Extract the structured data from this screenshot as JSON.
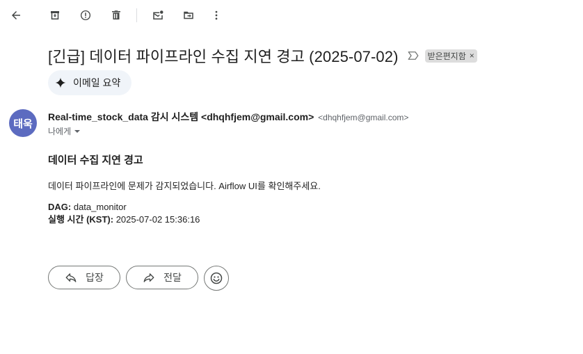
{
  "toolbar": {
    "icons": [
      "back-arrow-icon",
      "archive-icon",
      "report-spam-icon",
      "delete-icon",
      "mark-unread-icon",
      "move-to-icon",
      "more-options-icon"
    ]
  },
  "email": {
    "subject": "[긴급] 데이터 파이프라인 수집 지연 경고 (2025-07-02)",
    "label": "받은편지함",
    "label_remove": "×",
    "summary_label": "이메일 요약",
    "sender": {
      "avatar_text": "태욱",
      "avatar_color": "#5c6bc0",
      "display": "Real-time_stock_data 감시 시스템 <dhqhfjem@gmail.com>",
      "email": "<dhqhfjem@gmail.com>",
      "to": "나에게"
    },
    "body": {
      "heading": "데이터 수집 지연 경고",
      "message": "데이터 파이프라인에 문제가 감지되었습니다. Airflow UI를 확인해주세요.",
      "dag_label": "DAG:",
      "dag_value": "data_monitor",
      "time_label": "실행 시간 (KST):",
      "time_value": "2025-07-02 15:36:16"
    }
  },
  "actions": {
    "reply": "답장",
    "forward": "전달"
  }
}
